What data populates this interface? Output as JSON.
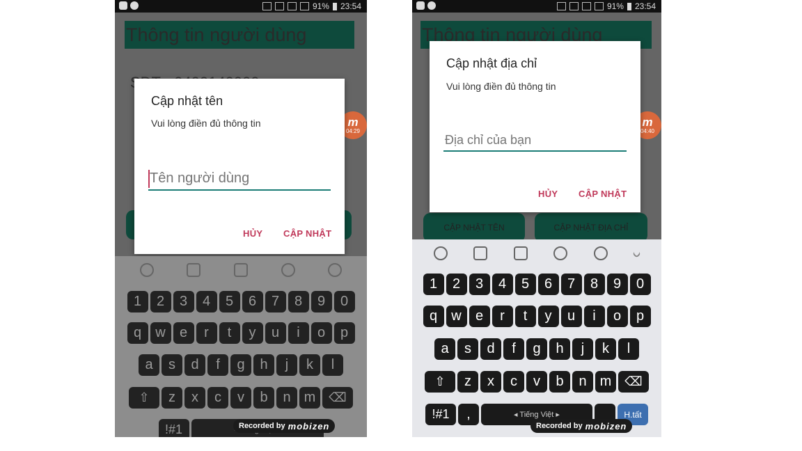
{
  "status_bar": {
    "battery": "91%",
    "time": "23:54"
  },
  "app": {
    "title": "Thông tin người dùng",
    "sdt_fragment": "SĐT - 0400140000",
    "btn_update_name": "CẬP NHẬT TÊN",
    "btn_update_address": "CẬP NHẬT ĐỊA CHỈ"
  },
  "record_badge": {
    "logo": "m",
    "time_left": "04:29",
    "time_right": "04:40"
  },
  "dialog_name": {
    "title": "Cập nhật tên",
    "message": "Vui lòng điền đủ thông tin",
    "placeholder": "Tên người dùng",
    "cancel": "HỦY",
    "confirm": "CẬP NHẬT"
  },
  "dialog_address": {
    "title": "Cập nhật địa chỉ",
    "message": "Vui lòng điền đủ thông tin",
    "placeholder": "Địa chỉ của bạn",
    "cancel": "HỦY",
    "confirm": "CẬP NHẬT"
  },
  "keyboard": {
    "numbers": [
      "1",
      "2",
      "3",
      "4",
      "5",
      "6",
      "7",
      "8",
      "9",
      "0"
    ],
    "row1": [
      "q",
      "w",
      "e",
      "r",
      "t",
      "y",
      "u",
      "i",
      "o",
      "p"
    ],
    "row2": [
      "a",
      "s",
      "d",
      "f",
      "g",
      "h",
      "j",
      "k",
      "l"
    ],
    "row3": [
      "z",
      "x",
      "c",
      "v",
      "b",
      "n",
      "m"
    ],
    "symbols_key": "!#1",
    "comma_key": ",",
    "space_label": "◂ Tiếng Việt ▸",
    "enter_label": "H.tất"
  },
  "watermark": {
    "text": "Recorded by",
    "brand": "mobizen"
  }
}
